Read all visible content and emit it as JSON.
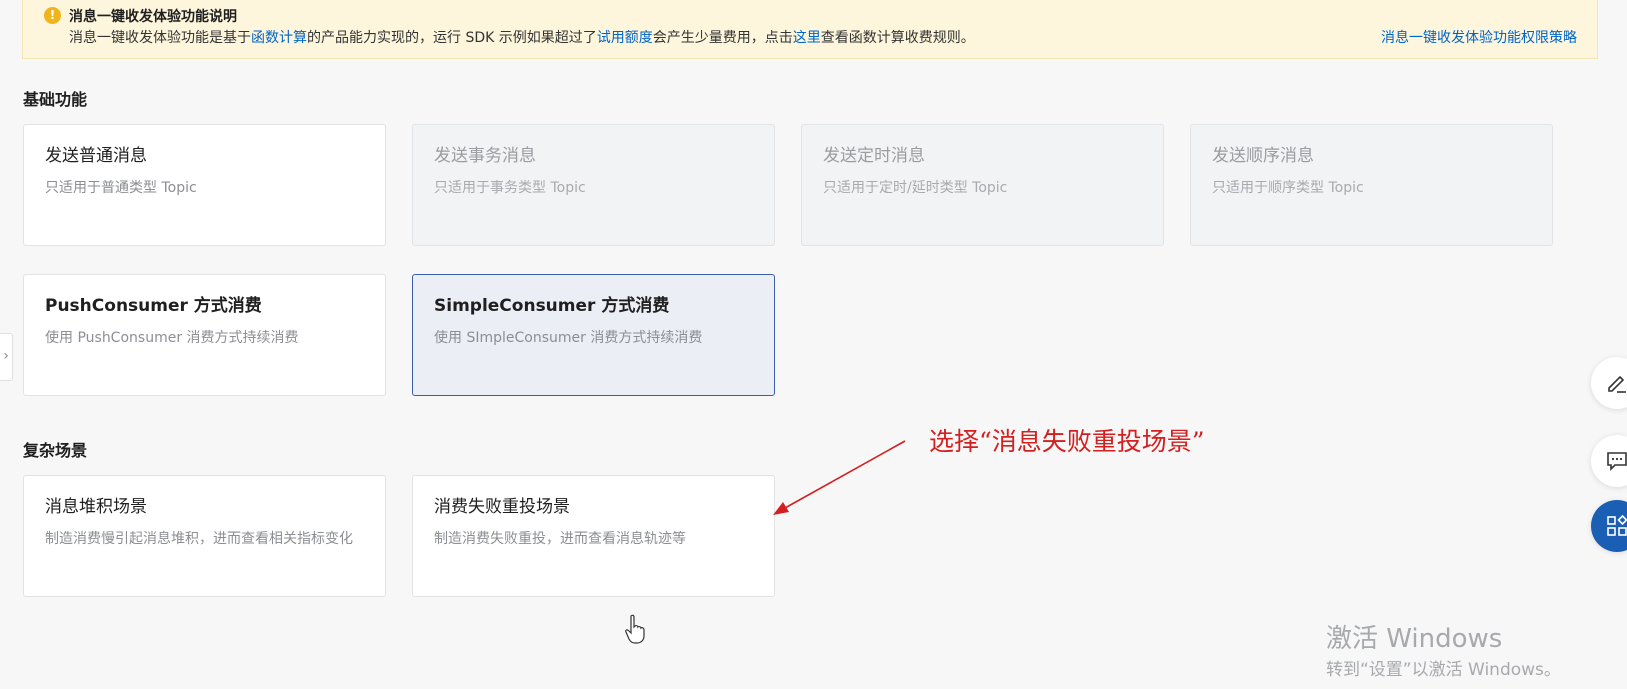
{
  "notice": {
    "icon": "warning-icon",
    "title": "消息一键收发体验功能说明",
    "desc_part1": "消息一键收发体验功能是基于",
    "desc_link1": "函数计算",
    "desc_part2": "的产品能力实现的，运行 SDK 示例如果超过了",
    "desc_link2": "试用额度",
    "desc_part3": "会产生少量费用，点击",
    "desc_link3": "这里",
    "desc_part4": "查看函数计算收费规则。",
    "policy_link": "消息一键收发体验功能权限策略"
  },
  "basic": {
    "title": "基础功能",
    "cards": [
      {
        "title": "发送普通消息",
        "desc": "只适用于普通类型 Topic"
      },
      {
        "title": "发送事务消息",
        "desc": "只适用于事务类型 Topic"
      },
      {
        "title": "发送定时消息",
        "desc": "只适用于定时/延时类型 Topic"
      },
      {
        "title": "发送顺序消息",
        "desc": "只适用于顺序类型 Topic"
      },
      {
        "title": "PushConsumer 方式消费",
        "desc": "使用 PushConsumer 消费方式持续消费"
      },
      {
        "title": "SimpleConsumer 方式消费",
        "desc": "使用 SImpleConsumer 消费方式持续消费"
      }
    ]
  },
  "complex": {
    "title": "复杂场景",
    "cards": [
      {
        "title": "消息堆积场景",
        "desc": "制造消费慢引起消息堆积，进而查看相关指标变化"
      },
      {
        "title": "消费失败重投场景",
        "desc": "制造消费失败重投，进而查看消息轨迹等"
      }
    ]
  },
  "annotation": "选择“消息失败重投场景”",
  "floating": [
    "edit-icon",
    "chat-icon",
    "apps-icon"
  ],
  "watermark": {
    "line1": "激活 Windows",
    "line2": "转到“设置”以激活 Windows。"
  }
}
